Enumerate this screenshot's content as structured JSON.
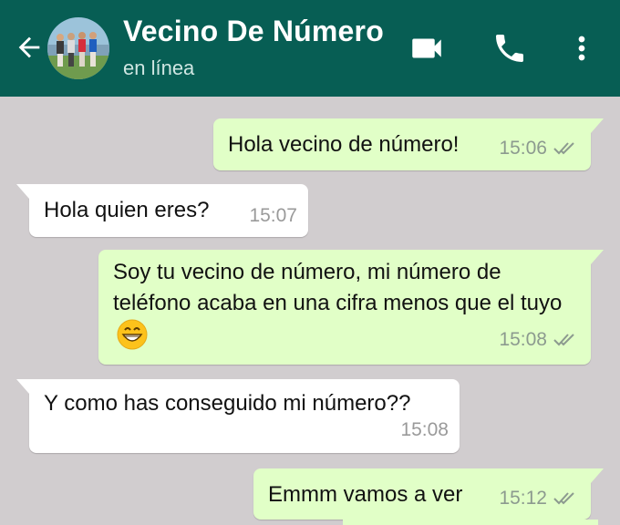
{
  "header": {
    "contact_name": "Vecino De Número",
    "status": "en línea",
    "bg_color": "#075e54",
    "icons": [
      "back-arrow-icon",
      "avatar",
      "video-call-icon",
      "phone-icon",
      "more-vert-icon"
    ]
  },
  "messages": [
    {
      "direction": "outgoing",
      "text": "Hola vecino de número!",
      "time": "15:06",
      "status": "read"
    },
    {
      "direction": "incoming",
      "text": "Hola quien eres?",
      "time": "15:07"
    },
    {
      "direction": "outgoing",
      "text": "Soy tu vecino de número, mi número de teléfono acaba en una cifra menos que el tuyo",
      "emoji": "grinning-face-emoji",
      "time": "15:08",
      "status": "read"
    },
    {
      "direction": "incoming",
      "text": "Y como has conseguido mi número??",
      "time": "15:08"
    },
    {
      "direction": "outgoing",
      "text": "Emmm vamos a ver",
      "time": "15:12",
      "status": "read"
    }
  ],
  "colors": {
    "outgoing_bubble": "#e1ffc7",
    "incoming_bubble": "#ffffff",
    "chat_background": "#d1cdcf"
  }
}
